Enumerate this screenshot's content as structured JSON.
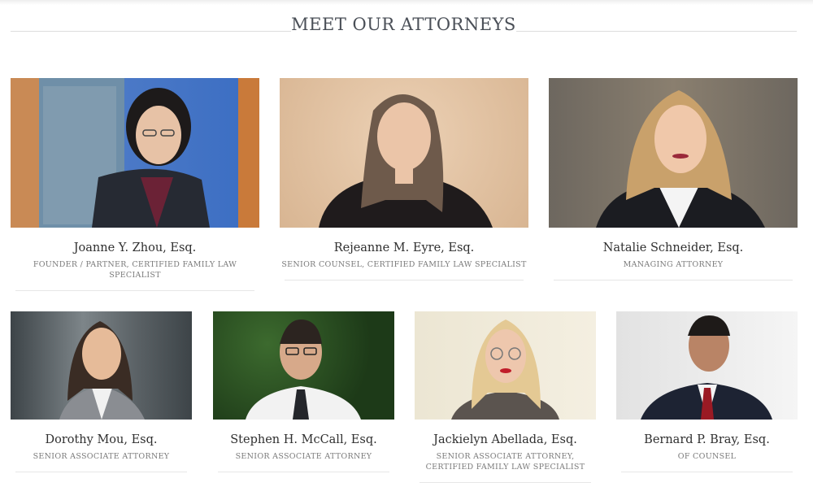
{
  "section": {
    "heading": "MEET OUR ATTORNEYS"
  },
  "attorneys_top": [
    {
      "name": "Joanne Y. Zhou, Esq.",
      "title": "FOUNDER / PARTNER, CERTIFIED FAMILY LAW SPECIALIST"
    },
    {
      "name": "Rejeanne M. Eyre, Esq.",
      "title": "SENIOR COUNSEL, CERTIFIED FAMILY LAW SPECIALIST"
    },
    {
      "name": "Natalie Schneider, Esq.",
      "title": "MANAGING ATTORNEY"
    }
  ],
  "attorneys_bottom": [
    {
      "name": "Dorothy Mou, Esq.",
      "title": "SENIOR ASSOCIATE ATTORNEY"
    },
    {
      "name": "Stephen H. McCall, Esq.",
      "title": "SENIOR ASSOCIATE ATTORNEY"
    },
    {
      "name": "Jackielyn Abellada, Esq.",
      "title": "SENIOR ASSOCIATE ATTORNEY, CERTIFIED FAMILY LAW SPECIALIST"
    },
    {
      "name": "Bernard P. Bray, Esq.",
      "title": "OF COUNSEL"
    }
  ]
}
